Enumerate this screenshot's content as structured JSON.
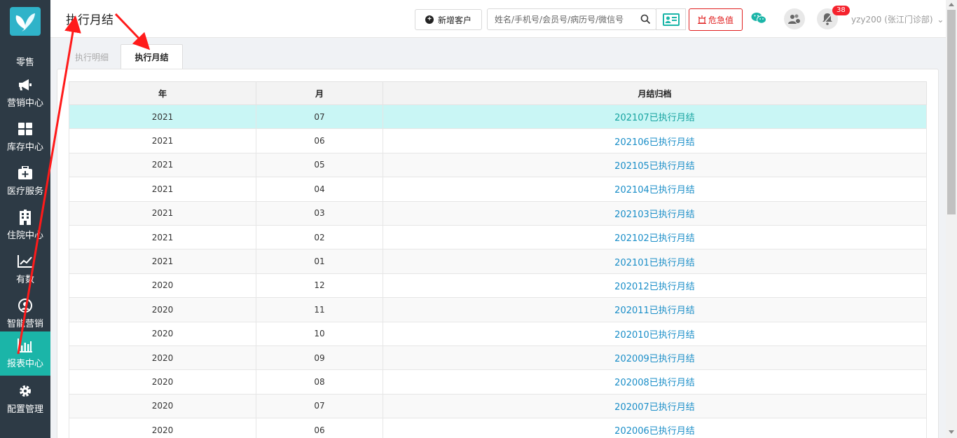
{
  "sidebar": {
    "items": [
      {
        "label": "零售",
        "icon": "retail-icon"
      },
      {
        "label": "营销中心",
        "icon": "megaphone-icon"
      },
      {
        "label": "库存中心",
        "icon": "grid-icon"
      },
      {
        "label": "医疗服务",
        "icon": "medical-kit-icon"
      },
      {
        "label": "住院中心",
        "icon": "hospital-building-icon"
      },
      {
        "label": "有数",
        "icon": "trend-chart-icon"
      },
      {
        "label": "智能营销",
        "icon": "smart-marketing-icon"
      },
      {
        "label": "报表中心",
        "icon": "bar-chart-icon",
        "active": true
      },
      {
        "label": "配置管理",
        "icon": "gear-icon"
      }
    ]
  },
  "header": {
    "title": "执行月结",
    "new_customer_label": "新增客户",
    "search_placeholder": "姓名/手机号/会员号/病历号/微信号",
    "critical_label": "危急值",
    "notification_count": "38",
    "user": "yzy200 (张江门诊部)"
  },
  "tabs": [
    {
      "label": "执行明细",
      "active": false
    },
    {
      "label": "执行月结",
      "active": true
    }
  ],
  "table": {
    "headers": [
      "年",
      "月",
      "月结归档"
    ],
    "rows": [
      {
        "year": "2021",
        "month": "07",
        "archive": "202107已执行月结"
      },
      {
        "year": "2021",
        "month": "06",
        "archive": "202106已执行月结"
      },
      {
        "year": "2021",
        "month": "05",
        "archive": "202105已执行月结"
      },
      {
        "year": "2021",
        "month": "04",
        "archive": "202104已执行月结"
      },
      {
        "year": "2021",
        "month": "03",
        "archive": "202103已执行月结"
      },
      {
        "year": "2021",
        "month": "02",
        "archive": "202102已执行月结"
      },
      {
        "year": "2021",
        "month": "01",
        "archive": "202101已执行月结"
      },
      {
        "year": "2020",
        "month": "12",
        "archive": "202012已执行月结"
      },
      {
        "year": "2020",
        "month": "11",
        "archive": "202011已执行月结"
      },
      {
        "year": "2020",
        "month": "10",
        "archive": "202010已执行月结"
      },
      {
        "year": "2020",
        "month": "09",
        "archive": "202009已执行月结"
      },
      {
        "year": "2020",
        "month": "08",
        "archive": "202008已执行月结"
      },
      {
        "year": "2020",
        "month": "07",
        "archive": "202007已执行月结"
      },
      {
        "year": "2020",
        "month": "06",
        "archive": "202006已执行月结"
      }
    ]
  },
  "colors": {
    "sidebar_bg": "#2d3a45",
    "sidebar_active": "#1bb5a8",
    "link": "#1a8ec8",
    "highlight_row": "#c9f6f5",
    "critical": "#e02020",
    "annotation_arrow": "#ff1a1a"
  }
}
